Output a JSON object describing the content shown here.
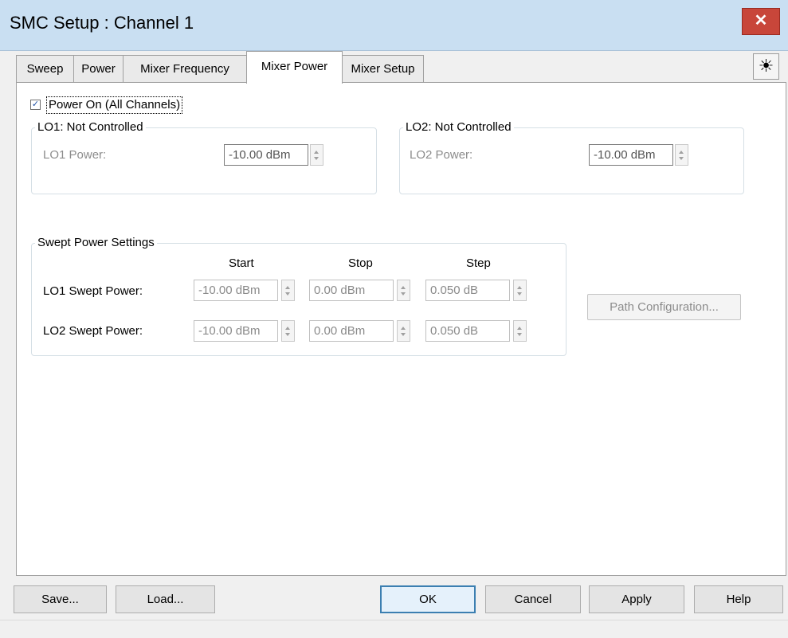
{
  "window": {
    "title": "SMC Setup : Channel 1",
    "close_glyph": "✕"
  },
  "tabs": [
    {
      "label": "Sweep"
    },
    {
      "label": "Power"
    },
    {
      "label": "Mixer Frequency"
    },
    {
      "label": "Mixer Power",
      "active": true
    },
    {
      "label": "Mixer Setup"
    }
  ],
  "brightness_icon": "☀",
  "power_on": {
    "label": "Power On (All Channels)",
    "checked": true,
    "check_glyph": "✓"
  },
  "lo1": {
    "group_title": "LO1: Not Controlled",
    "label": "LO1 Power:",
    "value": "-10.00 dBm"
  },
  "lo2": {
    "group_title": "LO2: Not Controlled",
    "label": "LO2 Power:",
    "value": "-10.00 dBm"
  },
  "swept": {
    "group_title": "Swept Power Settings",
    "columns": [
      "Start",
      "Stop",
      "Step"
    ],
    "rows": [
      {
        "label": "LO1 Swept Power:",
        "start": "-10.00 dBm",
        "stop": "0.00 dBm",
        "step": "0.050 dB"
      },
      {
        "label": "LO2 Swept Power:",
        "start": "-10.00 dBm",
        "stop": "0.00 dBm",
        "step": "0.050 dB"
      }
    ]
  },
  "path_config_label": "Path Configuration...",
  "buttons": {
    "save": "Save...",
    "load": "Load...",
    "ok": "OK",
    "cancel": "Cancel",
    "apply": "Apply",
    "help": "Help"
  },
  "colors": {
    "titlebar": "#c9dff2",
    "close": "#c8463a",
    "default_border": "#3c7fb1"
  }
}
